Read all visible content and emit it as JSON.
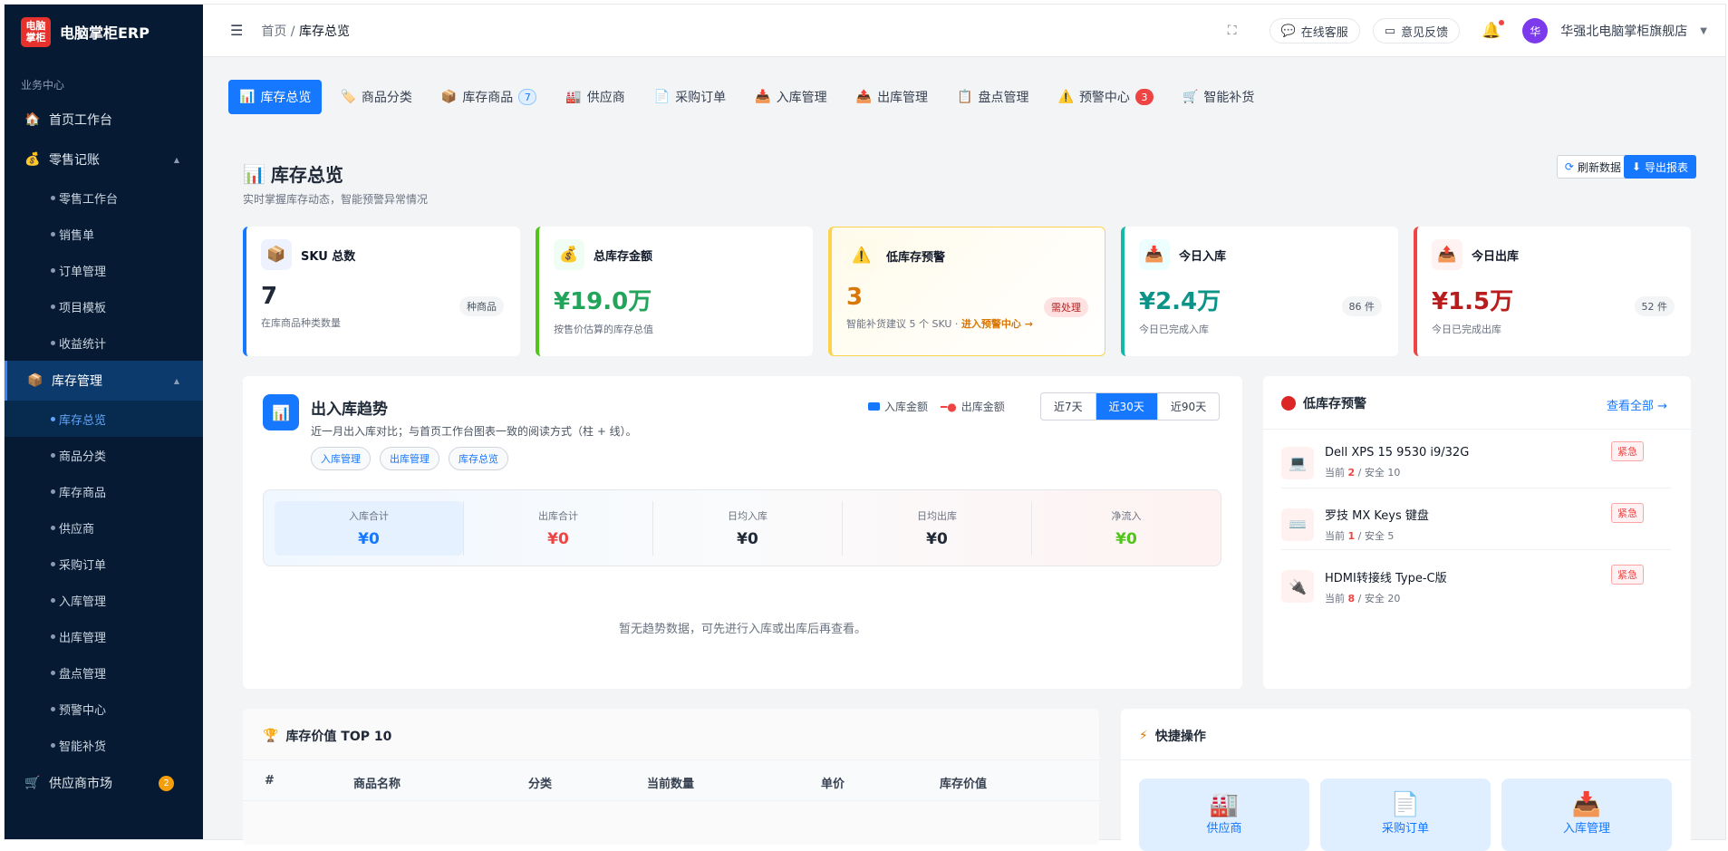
{
  "app": {
    "logo_mark": "电脑\n掌柜",
    "name": "电脑掌柜ERP"
  },
  "sidebar": {
    "section": "业务中心",
    "home": "首页工作台",
    "retail": {
      "label": "零售记账",
      "children": [
        "零售工作台",
        "销售单",
        "订单管理",
        "项目模板",
        "收益统计"
      ]
    },
    "inventory": {
      "label": "库存管理",
      "children": [
        "库存总览",
        "商品分类",
        "库存商品",
        "供应商",
        "采购订单",
        "入库管理",
        "出库管理",
        "盘点管理",
        "预警中心",
        "智能补货"
      ]
    },
    "market": {
      "label": "供应商市场",
      "badge": "2"
    }
  },
  "header": {
    "breadcrumb_home": "首页",
    "breadcrumb_sep": " / ",
    "breadcrumb_current": "库存总览",
    "service": "在线客服",
    "feedback": "意见反馈",
    "avatar_char": "华",
    "shop": "华强北电脑掌柜旗舰店"
  },
  "tabs": [
    {
      "label": "库存总览",
      "icon": "📊"
    },
    {
      "label": "商品分类",
      "icon": "🏷️"
    },
    {
      "label": "库存商品",
      "icon": "📦",
      "count": "7"
    },
    {
      "label": "供应商",
      "icon": "🏭"
    },
    {
      "label": "采购订单",
      "icon": "📄"
    },
    {
      "label": "入库管理",
      "icon": "📥"
    },
    {
      "label": "出库管理",
      "icon": "📤"
    },
    {
      "label": "盘点管理",
      "icon": "📋"
    },
    {
      "label": "预警中心",
      "icon": "⚠️",
      "count": "3"
    },
    {
      "label": "智能补货",
      "icon": "🛒"
    }
  ],
  "page": {
    "title": "库存总览",
    "subtitle": "实时掌握库存动态，智能预警异常情况",
    "refresh": "刷新数据",
    "export": "导出报表"
  },
  "cards": [
    {
      "title": "SKU 总数",
      "value": "7",
      "tag": "种商品",
      "sub": "在库商品种类数量",
      "color": "#1f2937",
      "border": "#1677ff",
      "bg": "#eef2ff",
      "icon": "📦"
    },
    {
      "title": "总库存金额",
      "value": "¥19.0万",
      "tag": "",
      "sub": "按售价估算的库存总值",
      "color": "#22a55a",
      "border": "#52c41a",
      "bg": "#f0fdf4",
      "icon": "💰"
    },
    {
      "title": "低库存预警",
      "value": "3",
      "tag": "需处理",
      "sub": "智能补货建议 5 个 SKU · ",
      "link": "进入预警中心 →",
      "color": "#d97706",
      "border": "#fcd34d",
      "bg": "#fffbeb",
      "icon": "⚠️"
    },
    {
      "title": "今日入库",
      "value": "¥2.4万",
      "tag": "86 件",
      "sub": "今日已完成入库",
      "color": "#0d9488",
      "border": "#14b8a6",
      "bg": "#ecfeff",
      "icon": "📥"
    },
    {
      "title": "今日出库",
      "value": "¥1.5万",
      "tag": "52 件",
      "sub": "今日已完成出库",
      "color": "#b91c1c",
      "border": "#ef4444",
      "bg": "#fef2f2",
      "icon": "📤"
    }
  ],
  "trend": {
    "title": "出入库趋势",
    "desc": "近一月出入库对比；与首页工作台图表一致的阅读方式（柱 + 线）。",
    "legend_in": "入库金额",
    "legend_out": "出库金额",
    "ranges": [
      "近7天",
      "近30天",
      "近90天"
    ],
    "chips": [
      "入库管理",
      "出库管理",
      "库存总览"
    ],
    "stats": [
      {
        "label": "入库合计",
        "value": "¥0",
        "color": "#1677ff"
      },
      {
        "label": "出库合计",
        "value": "¥0",
        "color": "#ef4444"
      },
      {
        "label": "日均入库",
        "value": "¥0",
        "color": "#111827"
      },
      {
        "label": "日均出库",
        "value": "¥0",
        "color": "#111827"
      },
      {
        "label": "净流入",
        "value": "¥0",
        "color": "#52c41a"
      }
    ],
    "empty": "暂无趋势数据，可先进行入库或出库后再查看。"
  },
  "low_stock": {
    "title": "低库存预警",
    "view_all": "查看全部 →",
    "items": [
      {
        "name": "Dell XPS 15 9530 i9/32G",
        "icon": "💻",
        "cur_label": "当前 ",
        "current": "2",
        "safe_label": " / 安全 ",
        "safe": "10",
        "tag": "紧急"
      },
      {
        "name": "罗技 MX Keys 键盘",
        "icon": "⌨️",
        "cur_label": "当前 ",
        "current": "1",
        "safe_label": " / 安全 ",
        "safe": "5",
        "tag": "紧急"
      },
      {
        "name": "HDMI转接线 Type-C版",
        "icon": "🔌",
        "cur_label": "当前 ",
        "current": "8",
        "safe_label": " / 安全 ",
        "safe": "20",
        "tag": "紧急"
      }
    ]
  },
  "top10": {
    "title": "库存价值 TOP 10",
    "cols": [
      "#",
      "商品名称",
      "分类",
      "当前数量",
      "单价",
      "库存价值"
    ]
  },
  "quick": {
    "title": "快捷操作",
    "items": [
      {
        "label": "供应商",
        "icon": "🏭"
      },
      {
        "label": "采购订单",
        "icon": "📄"
      },
      {
        "label": "入库管理",
        "icon": "📥"
      }
    ]
  }
}
